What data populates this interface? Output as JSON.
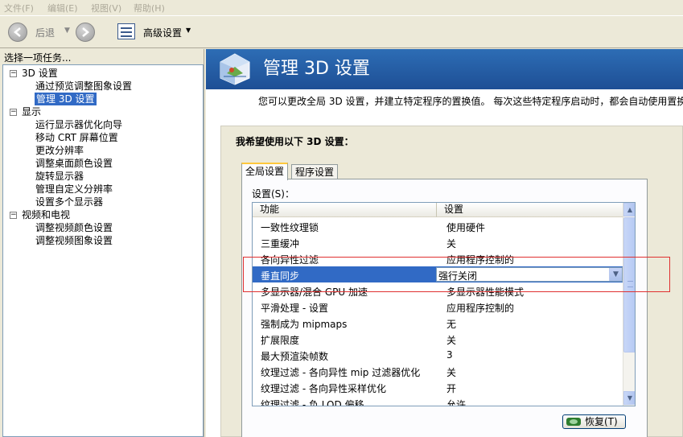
{
  "menu": [
    "文件(F)",
    "编辑(E)",
    "视图(V)",
    "帮助(H)"
  ],
  "toolbar": {
    "back_label": "后退",
    "advanced_label": "高级设置"
  },
  "task_pane": {
    "title": "选择一项任务...",
    "categories": [
      {
        "label": "3D 设置",
        "items": [
          "通过预览调整图象设置",
          "管理 3D 设置"
        ]
      },
      {
        "label": "显示",
        "items": [
          "运行显示器优化向导",
          "移动 CRT 屏幕位置",
          "更改分辨率",
          "调整桌面颜色设置",
          "旋转显示器",
          "管理自定义分辨率",
          "设置多个显示器"
        ]
      },
      {
        "label": "视频和电视",
        "items": [
          "调整视频颜色设置",
          "调整视频图象设置"
        ]
      }
    ],
    "selected_item": "管理 3D 设置"
  },
  "page": {
    "title": "管理 3D 设置",
    "description": "您可以更改全局 3D 设置，并建立特定程序的置换值。 每次这些特定程序启动时，都会自动使用置换"
  },
  "settings": {
    "heading": "我希望使用以下 3D 设置：",
    "tabs": [
      "全局设置",
      "程序设置"
    ],
    "active_tab": "全局设置",
    "label": "设置(S)：",
    "columns": [
      "功能",
      "设置"
    ],
    "rows": [
      {
        "feature": "一致性纹理锁",
        "value": "使用硬件"
      },
      {
        "feature": "三重缓冲",
        "value": "关"
      },
      {
        "feature": "各向异性过滤",
        "value": "应用程序控制的"
      },
      {
        "feature": "垂直同步",
        "value": "强行关闭"
      },
      {
        "feature": "多显示器/混合 GPU 加速",
        "value": "多显示器性能模式"
      },
      {
        "feature": "平滑处理 - 设置",
        "value": "应用程序控制的"
      },
      {
        "feature": "强制成为 mipmaps",
        "value": "无"
      },
      {
        "feature": "扩展限度",
        "value": "关"
      },
      {
        "feature": "最大预渲染帧数",
        "value": "3"
      },
      {
        "feature": "纹理过滤 - 各向异性 mip 过滤器优化",
        "value": "关"
      },
      {
        "feature": "纹理过滤 - 各向异性采样优化",
        "value": "开"
      },
      {
        "feature": "纹理过滤 - 负 LOD 偏移",
        "value": "允许"
      }
    ],
    "selected_row": "垂直同步",
    "restore_label": "恢复(T)"
  },
  "colors": {
    "banner": "#1e4f95",
    "selection": "#316ac5",
    "highlight_box": "#e03030"
  }
}
